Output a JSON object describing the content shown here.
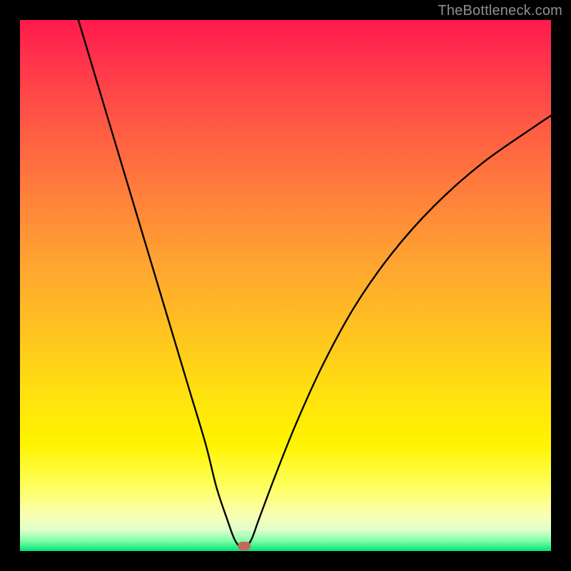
{
  "watermark": "TheBottleneck.com",
  "marker": {
    "x_pct": 42.2,
    "y_pct": 99.0,
    "color": "#c26a5a"
  },
  "chart_data": {
    "type": "line",
    "title": "",
    "xlabel": "",
    "ylabel": "",
    "xlim": [
      0,
      100
    ],
    "ylim": [
      0,
      100
    ],
    "grid": false,
    "legend": false,
    "series": [
      {
        "name": "bottleneck-curve",
        "x": [
          11,
          14,
          17,
          20,
          23,
          26,
          29,
          32,
          35,
          37,
          39,
          40.5,
          42,
          43.5,
          45,
          48,
          52,
          57,
          63,
          70,
          78,
          87,
          97,
          100
        ],
        "y": [
          100,
          90,
          80,
          70,
          60,
          50,
          40,
          30,
          20,
          12,
          6,
          2,
          0.5,
          2,
          6,
          14,
          24,
          35,
          46,
          56,
          65,
          73,
          80,
          82
        ]
      }
    ],
    "annotations": [
      {
        "type": "marker",
        "x": 42.2,
        "y": 0.5,
        "shape": "rounded-rect",
        "color": "#c26a5a"
      }
    ],
    "background_gradient": {
      "top": "#ff1a4d",
      "bottom": "#00e577",
      "meaning": "red=high bottleneck, green=optimal"
    }
  }
}
